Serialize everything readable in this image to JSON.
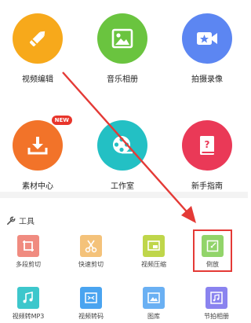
{
  "big_items": [
    {
      "label": "视频编辑",
      "icon": "pencil-icon",
      "color": "#f7a91b"
    },
    {
      "label": "音乐相册",
      "icon": "image-icon",
      "color": "#6ac43f"
    },
    {
      "label": "拍摄录像",
      "icon": "video-camera-icon",
      "color": "#5c86f2"
    },
    {
      "label": "素材中心",
      "icon": "download-icon",
      "color": "#f27329",
      "badge": "NEW"
    },
    {
      "label": "工作室",
      "icon": "film-reel-icon",
      "color": "#23c0c4"
    },
    {
      "label": "新手指南",
      "icon": "book-icon",
      "color": "#ea3957"
    }
  ],
  "tools_header": {
    "label": "工具",
    "icon": "wrench-icon"
  },
  "tools": [
    {
      "label": "多段剪切",
      "icon": "crop-icon",
      "color": "#f08b80"
    },
    {
      "label": "快速剪切",
      "icon": "scissors-icon",
      "color": "#f4c27a"
    },
    {
      "label": "视频压缩",
      "icon": "compress-icon",
      "color": "#bfd64a"
    },
    {
      "label": "倒放",
      "icon": "reverse-icon",
      "color": "#92d46a"
    },
    {
      "label": "视频转MP3",
      "icon": "music-note-icon",
      "color": "#3dc7cc"
    },
    {
      "label": "视频转码",
      "icon": "transcode-icon",
      "color": "#4aa4f0"
    },
    {
      "label": "图库",
      "icon": "gallery-icon",
      "color": "#6ab0f3"
    },
    {
      "label": "节拍相册",
      "icon": "beat-album-icon",
      "color": "#8a83ef"
    }
  ],
  "annotation_color": "#e43a36"
}
